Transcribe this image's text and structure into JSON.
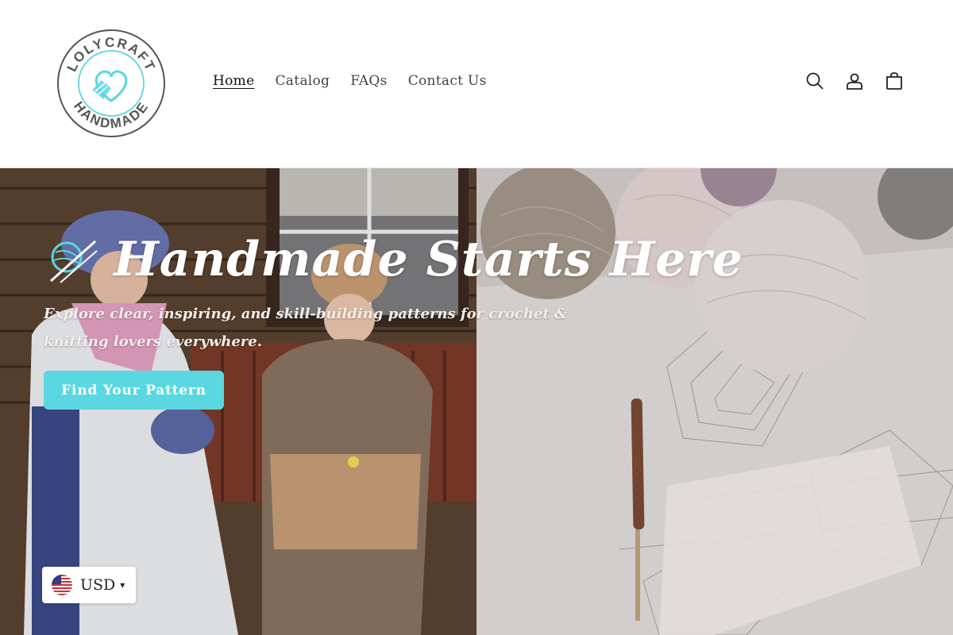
{
  "brand": {
    "logo_text_top": "LOLYCRAFT",
    "logo_text_bottom": "HANDMADE",
    "accent": "#5ad7e0",
    "logo_color": "#555555"
  },
  "nav": {
    "items": [
      {
        "label": "Home",
        "active": true
      },
      {
        "label": "Catalog",
        "active": false
      },
      {
        "label": "FAQs",
        "active": false
      },
      {
        "label": "Contact Us",
        "active": false
      }
    ]
  },
  "header_icons": [
    "search-icon",
    "account-icon",
    "cart-icon"
  ],
  "hero": {
    "title": "Handmade Starts Here",
    "subtitle": "Explore clear, inspiring, and skill-building patterns for crochet & knitting lovers everywhere.",
    "cta_label": "Find Your Pattern"
  },
  "currency": {
    "code": "USD",
    "flag": "us-flag-icon"
  }
}
